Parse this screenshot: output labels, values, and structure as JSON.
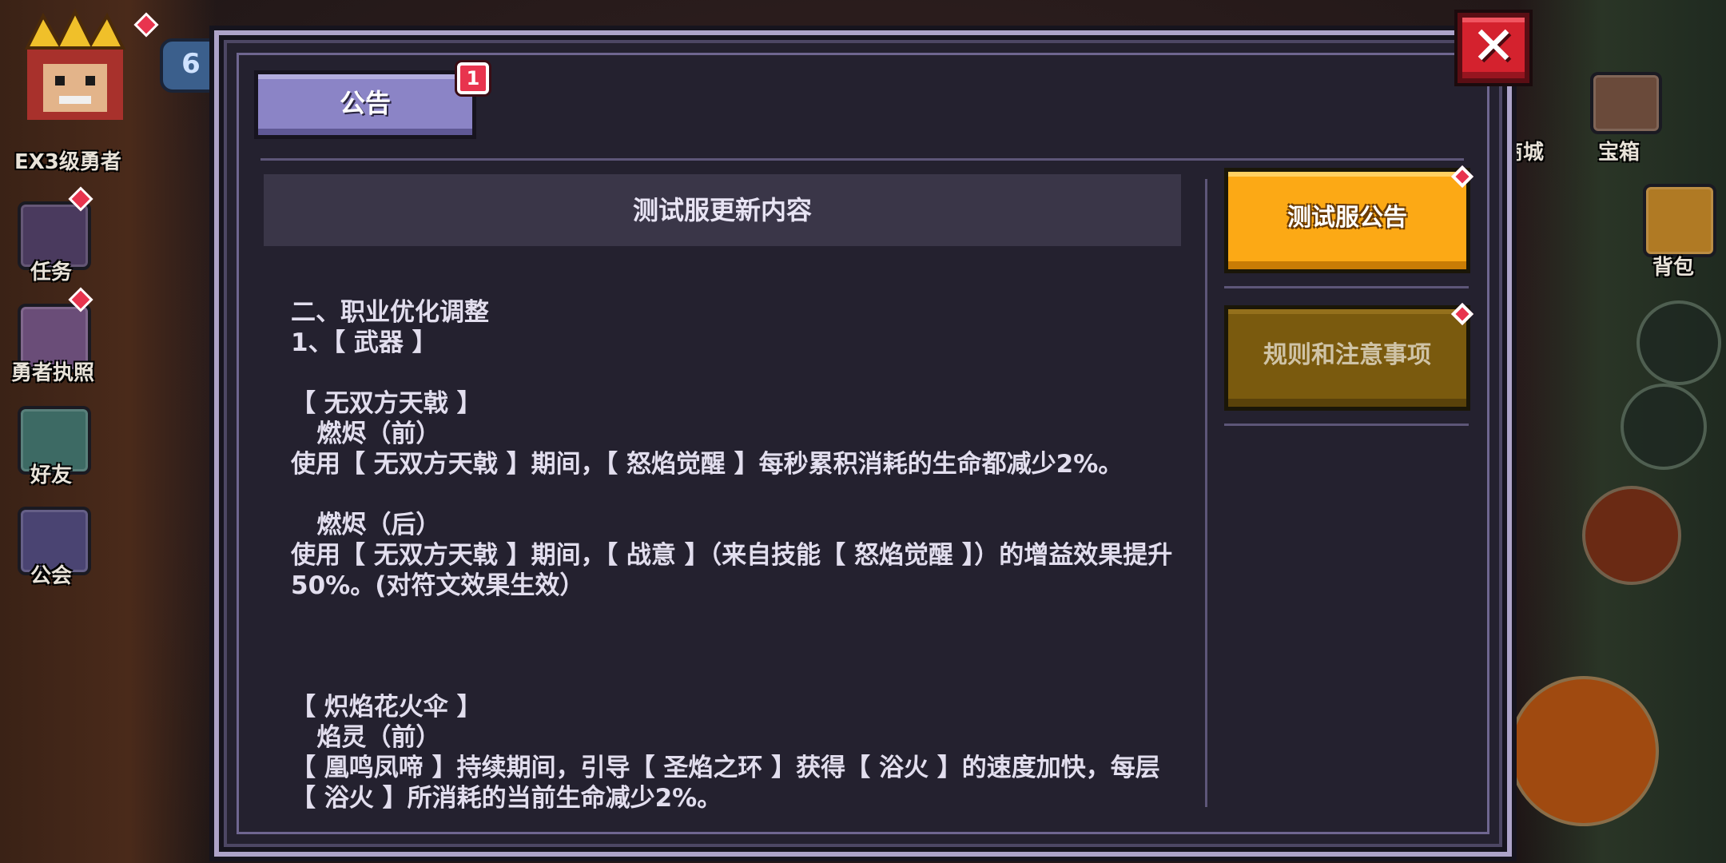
{
  "background_hud": {
    "player_title": "EX3级勇者",
    "level_badge": "6",
    "left_menu": [
      {
        "label": "任务",
        "icon": "trophy-icon"
      },
      {
        "label": "勇者执照",
        "icon": "license-icon"
      },
      {
        "label": "好友",
        "icon": "friend-icon"
      },
      {
        "label": "公会",
        "icon": "guild-icon"
      }
    ],
    "right_menu": [
      {
        "label": "商城",
        "icon": "shop-icon"
      },
      {
        "label": "宝箱",
        "icon": "chest-icon"
      },
      {
        "label": "背包",
        "icon": "backpack-icon"
      }
    ]
  },
  "dialog": {
    "close_symbol": "✕",
    "tab": {
      "label": "公告",
      "badge": "1"
    },
    "side_buttons": [
      {
        "label": "测试服公告",
        "active": true
      },
      {
        "label": "规则和注意事项",
        "active": false
      }
    ],
    "content_title": "测试服更新内容",
    "content_body": "二、职业优化调整\n1、【 武器 】\n\n【 无双方天戟 】\n   燃烬（前）\n使用【 无双方天戟 】期间，【 怒焰觉醒 】每秒累积消耗的生命都减少2%。\n\n   燃烬（后）\n使用【 无双方天戟 】期间，【 战意 】（来自技能【 怒焰觉醒 】）的增益效果提升50%。(对符文效果生效）\n\n\n\n【 炽焰花火伞 】\n   焰灵（前）\n【 凰鸣凤啼 】持续期间，引导【 圣焰之环 】获得【 浴火 】的速度加快，每层【 浴火 】所消耗的当前生命减少2%。"
  },
  "colors": {
    "accent_orange": "#fca915",
    "close_red": "#d4222e",
    "tab_purple": "#8b84c6",
    "panel_bg": "#24212f"
  }
}
